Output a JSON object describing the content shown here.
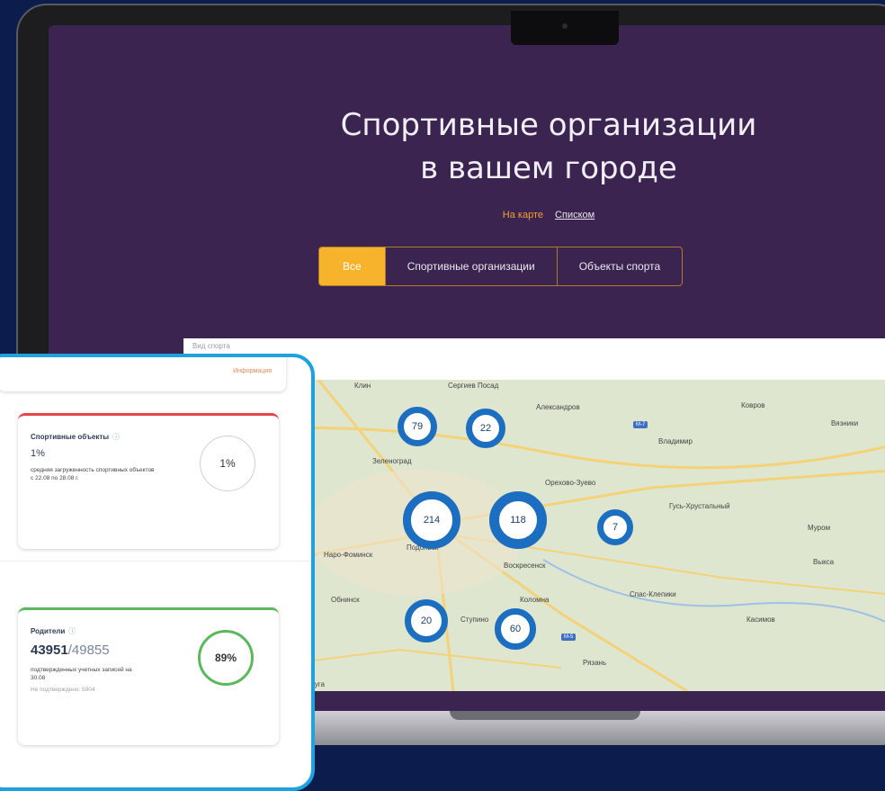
{
  "hero": {
    "title_line1": "Спортивные организации",
    "title_line2": "в вашем городе"
  },
  "view_switch": {
    "map": "На карте",
    "list": "Списком"
  },
  "tabs": [
    {
      "label": "Все",
      "active": true
    },
    {
      "label": "Спортивные организации",
      "active": false
    },
    {
      "label": "Объекты спорта",
      "active": false
    }
  ],
  "search": {
    "placeholder": "Вид спорта"
  },
  "map": {
    "clusters": [
      "79",
      "22",
      "214",
      "118",
      "7",
      "20",
      "60"
    ],
    "places": [
      "Клин",
      "Сергиев Посад",
      "Александров",
      "Ковров",
      "Вязники",
      "Владимир",
      "Зеленоград",
      "Орехово-Зуево",
      "Гусь-Хрустальный",
      "Муром",
      "Выкса",
      "Подольск",
      "Наро-Фоминск",
      "Воскресенск",
      "Обнинск",
      "Коломна",
      "Спас-Клепики",
      "Касимов",
      "Ступино",
      "Рязань",
      "Калуга"
    ]
  },
  "dashboard": {
    "top_link": "Информация",
    "sport_objects": {
      "title": "Спортивные объекты",
      "value": "1%",
      "description": "средняя загруженность спортивных объектов с 22.08 по 28.08 г.",
      "ring_label": "1%",
      "ring_percent": 1
    },
    "parents": {
      "title": "Родители",
      "value_confirmed": "43951",
      "value_total": "/49855",
      "description": "подтвержденных учетных записей на 30.08",
      "note": "Не подтверждено: 5904",
      "ring_label": "89%",
      "ring_percent": 89
    }
  },
  "colors": {
    "accent": "#f7b32b",
    "screen_bg": "#3b2450",
    "cluster": "#1b6ec0",
    "panel_border": "#1fa3e0",
    "red_line": "#e04848",
    "green_line": "#5cb85c"
  }
}
